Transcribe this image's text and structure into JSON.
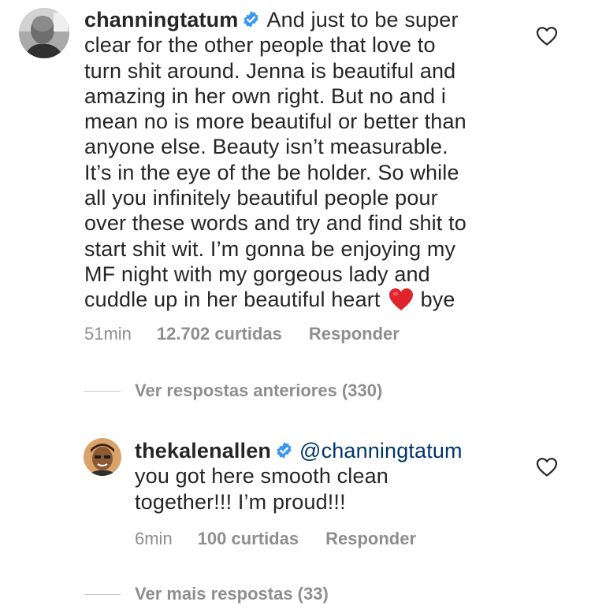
{
  "comments": [
    {
      "username": "channingtatum",
      "verified": true,
      "text_lines": [
        "And just to be super",
        "clear for the other people that love to",
        "turn shit around. Jenna is beautiful and",
        "amazing in her own right. But no and i",
        "mean no is more beautiful or better than",
        "anyone else. Beauty isn’t measurable.",
        "It’s in the eye of the be holder. So while",
        "all you infinitely beautiful people pour",
        "over these words and try and find shit to",
        "start shit wit. I’m gonna be enjoying my",
        "MF night with my gorgeous lady and",
        "cuddle up in her beautiful heart"
      ],
      "emoji": "red-heart",
      "text_end": "bye",
      "time": "51min",
      "likes": "12.702 curtidas",
      "reply_label": "Responder"
    },
    {
      "username": "thekalenallen",
      "verified": true,
      "mention": "@channingtatum",
      "text_lines": [
        "you got here smooth clean",
        "together!!! I’m proud!!!"
      ],
      "time": "6min",
      "likes": "100 curtidas",
      "reply_label": "Responder"
    }
  ],
  "view_previous_replies": "Ver respostas anteriores (330)",
  "view_more_replies": "Ver mais respostas (33)",
  "icons": {
    "like": "heart-outline-icon",
    "verified": "verified-badge-icon"
  },
  "colors": {
    "text": "#262626",
    "secondary": "#8e8e8e",
    "verified_blue": "#3897f0",
    "mention": "#003569",
    "emoji_heart": "#e0242c"
  }
}
